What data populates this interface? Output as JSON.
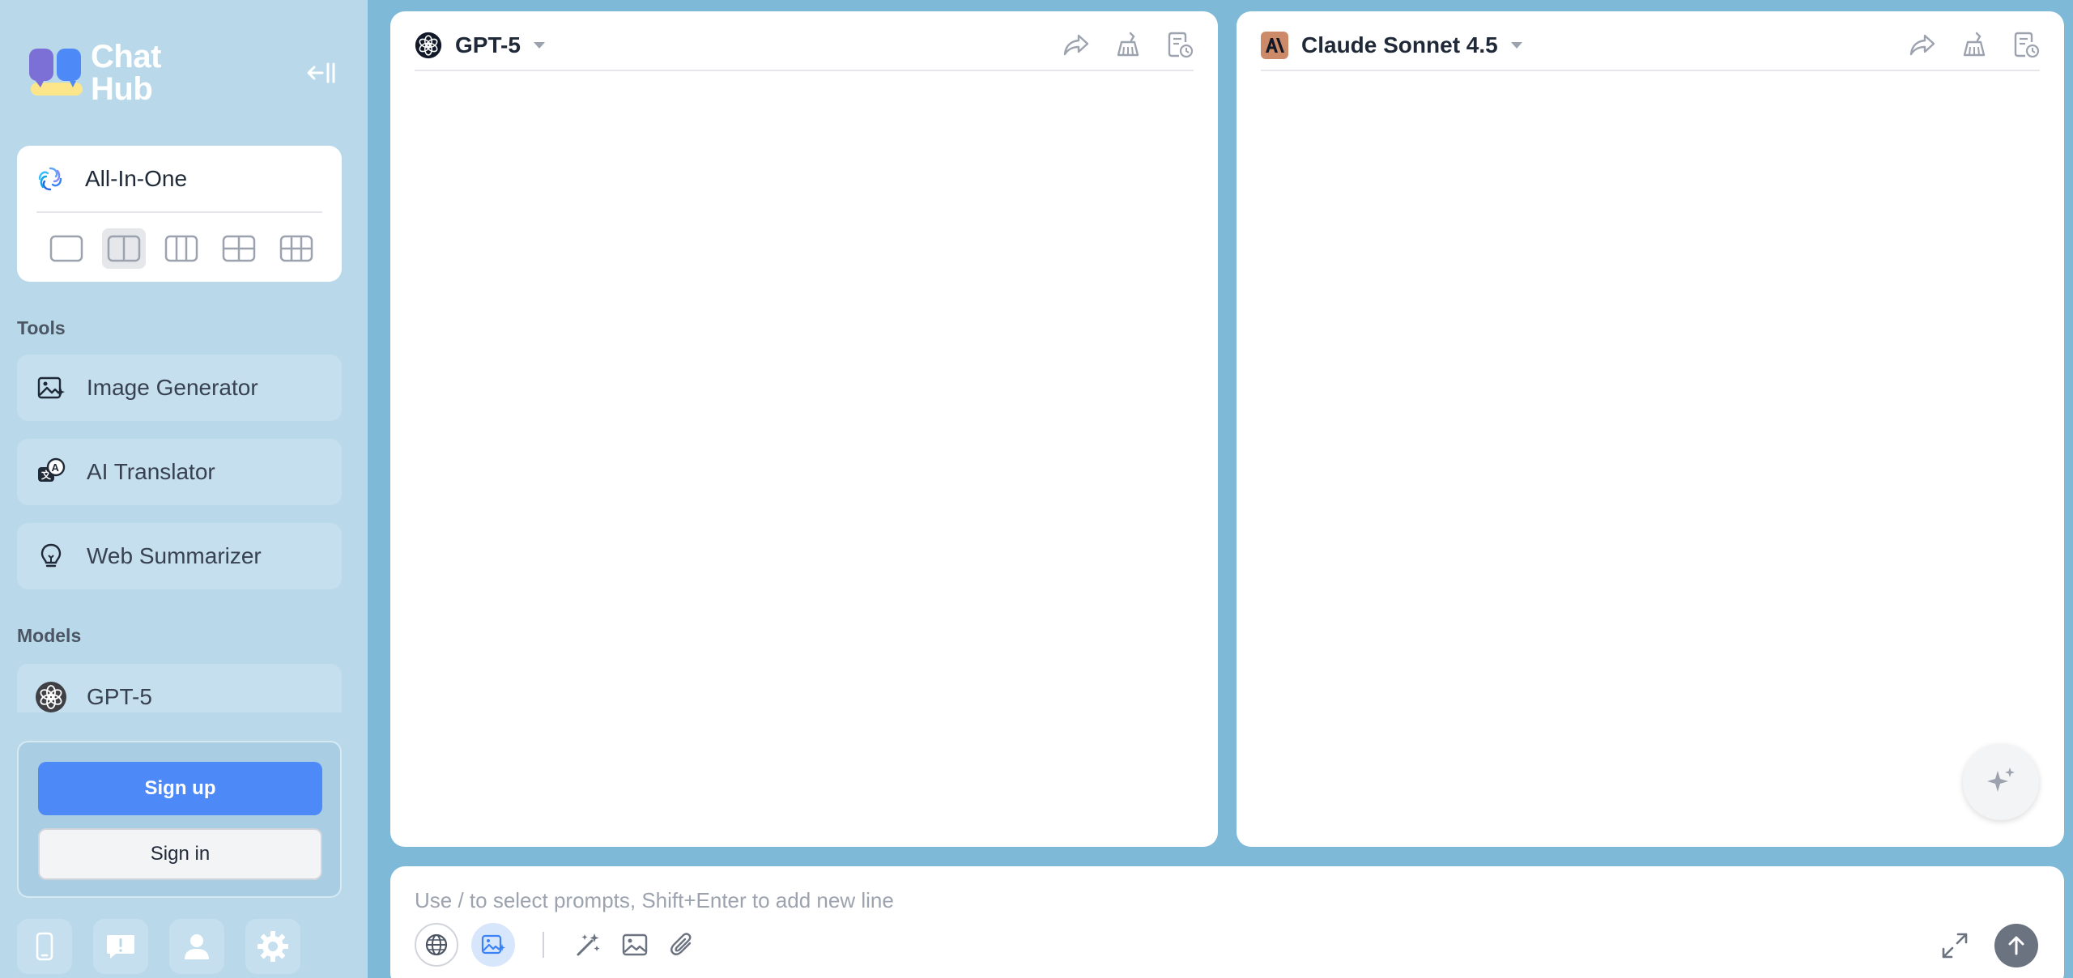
{
  "app": {
    "logo_line1": "Chat",
    "logo_line2": "Hub",
    "colors": {
      "background": "#7fb9d8",
      "sidebar": "#b9d9ea",
      "primary": "#4d8af7"
    }
  },
  "sidebar": {
    "all_in_one": {
      "label": "All-In-One",
      "icon": "spiral-logo-icon"
    },
    "layouts": [
      {
        "icon": "layout-single-icon",
        "active": false
      },
      {
        "icon": "layout-two-column-icon",
        "active": true
      },
      {
        "icon": "layout-three-column-icon",
        "active": false
      },
      {
        "icon": "layout-grid-2x2-icon",
        "active": false
      },
      {
        "icon": "layout-grid-3x2-icon",
        "active": false
      }
    ],
    "tools_title": "Tools",
    "tools": [
      {
        "label": "Image Generator",
        "icon": "image-sparkle-icon"
      },
      {
        "label": "AI Translator",
        "icon": "translate-icon"
      },
      {
        "label": "Web Summarizer",
        "icon": "lightbulb-icon"
      }
    ],
    "models_title": "Models",
    "models": [
      {
        "label": "GPT-5",
        "icon": "openai-icon"
      }
    ],
    "auth": {
      "signup_label": "Sign up",
      "signin_label": "Sign in"
    },
    "bottom_icons": [
      "mobile-icon",
      "feedback-icon",
      "user-icon",
      "settings-gear-icon"
    ]
  },
  "panels": [
    {
      "model_name": "GPT-5",
      "icon": "openai-icon"
    },
    {
      "model_name": "Claude Sonnet 4.5",
      "icon": "anthropic-icon"
    }
  ],
  "input": {
    "placeholder": "Use / to select prompts, Shift+Enter to add new line",
    "value": ""
  }
}
